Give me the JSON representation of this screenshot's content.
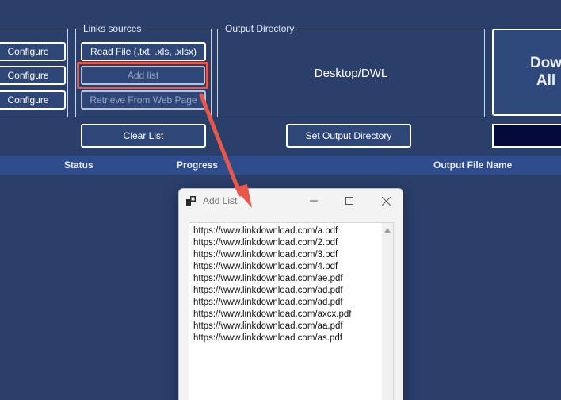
{
  "left_buttons": [
    "Configure",
    "Configure",
    "Configure"
  ],
  "links_sources": {
    "legend": "Links sources",
    "read_file": "Read File (.txt, .xls, .xlsx)",
    "add_list": "Add list",
    "retrieve": "Retrieve From Web Page",
    "clear_list": "Clear List"
  },
  "output_directory": {
    "legend": "Output Directory",
    "value": "Desktop/DWL",
    "set_button": "Set Output Directory"
  },
  "download_all": {
    "line1": "Dow",
    "line2": "All"
  },
  "columns": {
    "status": "Status",
    "progress": "Progress",
    "output_file_name": "Output File Name"
  },
  "dialog": {
    "title": "Add List",
    "urls": [
      "https://www.linkdownload.com/a.pdf",
      "https://www.linkdownload.com/2.pdf",
      "https://www.linkdownload.com/3.pdf",
      "https://www.linkdownload.com/4.pdf",
      "https://www.linkdownload.com/ae.pdf",
      "https://www.linkdownload.com/ad.pdf",
      "https://www.linkdownload.com/ad.pdf",
      "https://www.linkdownload.com/axcx.pdf",
      "https://www.linkdownload.com/aa.pdf",
      "https://www.linkdownload.com/as.pdf"
    ]
  },
  "colors": {
    "background": "#2b3f6b",
    "highlight": "#e8574a",
    "header_row": "#2f4d8c"
  }
}
